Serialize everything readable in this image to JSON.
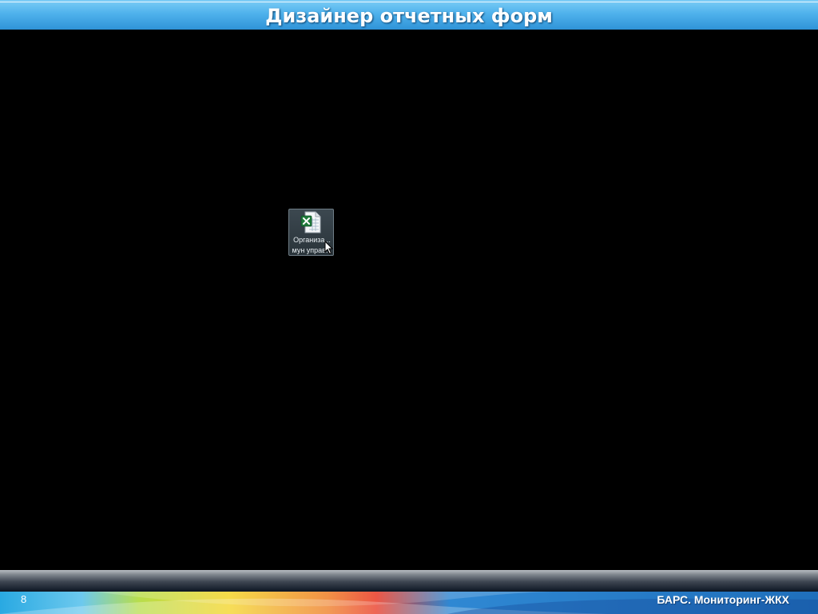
{
  "slide": {
    "title": "Дизайнер отчетных форм",
    "page_number": "8",
    "footer_brand": "БАРС. Мониторинг-ЖКХ"
  },
  "desktop": {
    "file_icon": {
      "type": "excel-spreadsheet-icon",
      "label_line1": "Организа...",
      "label_line2": "мун управ..."
    }
  },
  "colors": {
    "title_bar": "#4fb2ec",
    "background": "#000000",
    "footer_blue": "#1f6fbb",
    "excel_green": "#1e7a3a"
  }
}
